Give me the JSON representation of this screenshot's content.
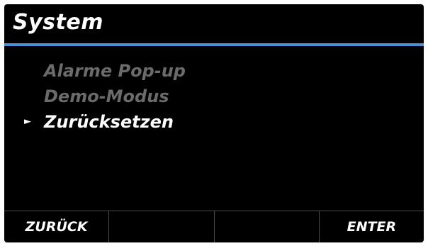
{
  "header": {
    "title": "System"
  },
  "menu": {
    "pointer": "►",
    "items": [
      {
        "label": "Alarme Pop-up",
        "selected": false
      },
      {
        "label": "Demo-Modus",
        "selected": false
      },
      {
        "label": "Zurücksetzen",
        "selected": true
      }
    ]
  },
  "softkeys": [
    {
      "label": "ZURÜCK"
    },
    {
      "label": ""
    },
    {
      "label": ""
    },
    {
      "label": "ENTER"
    }
  ],
  "colors": {
    "background": "#000000",
    "accent_rule": "#4a8fd8",
    "text_active": "#ffffff",
    "text_inactive": "#6b6b6b",
    "divider": "#4a4a4a"
  }
}
